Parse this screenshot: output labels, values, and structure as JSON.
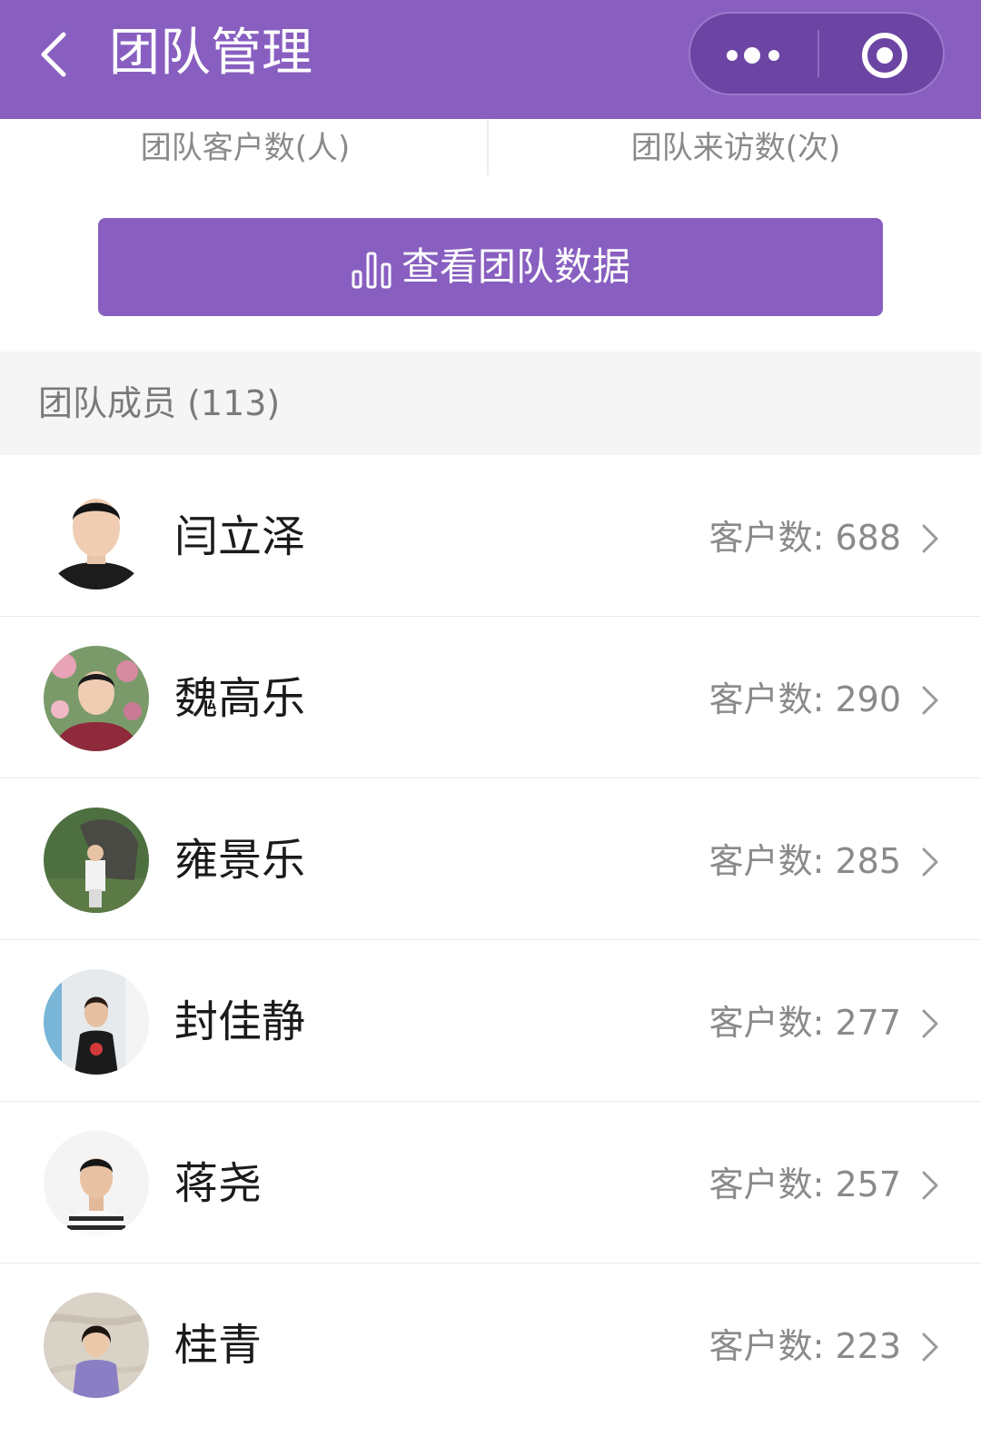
{
  "header": {
    "title": "团队管理",
    "back_icon": "chevron-left-icon",
    "more_icon": "more-dots-icon",
    "close_icon": "target-close-icon",
    "bg_color": "#885fc0"
  },
  "stats": {
    "left_label": "团队客户数(人)",
    "right_label": "团队来访数(次)"
  },
  "action": {
    "label": "查看团队数据",
    "icon": "bar-chart-icon",
    "color": "#885fc0"
  },
  "section": {
    "title": "团队成员 (113)"
  },
  "members": [
    {
      "name": "闫立泽",
      "count": "客户数: 688",
      "avatar": "avatar-man-suit"
    },
    {
      "name": "魏高乐",
      "count": "客户数: 290",
      "avatar": "avatar-man-flowers"
    },
    {
      "name": "雍景乐",
      "count": "客户数: 285",
      "avatar": "avatar-man-statue"
    },
    {
      "name": "封佳静",
      "count": "客户数: 277",
      "avatar": "avatar-woman-room"
    },
    {
      "name": "蒋尧",
      "count": "客户数: 257",
      "avatar": "avatar-man-white"
    },
    {
      "name": "桂青",
      "count": "客户数: 223",
      "avatar": "avatar-woman-marble"
    }
  ]
}
